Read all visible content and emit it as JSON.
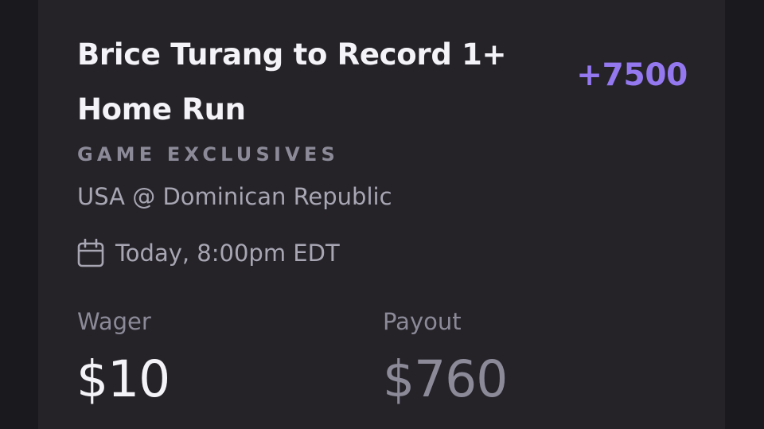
{
  "bet": {
    "title": "Brice Turang to Record 1+ Home Run",
    "odds": "+7500",
    "category": "GAME EXCLUSIVES",
    "matchup": "USA @ Dominican Republic",
    "date_icon": "calendar-icon",
    "date": "Today, 8:00pm EDT"
  },
  "summary": {
    "wager_label": "Wager",
    "wager_value": "$10",
    "payout_label": "Payout",
    "payout_value": "$760"
  },
  "colors": {
    "background": "#1a191d",
    "card": "#252328",
    "title": "#f4f3f7",
    "odds_accent": "#9478f0",
    "muted": "#8c8a98"
  }
}
